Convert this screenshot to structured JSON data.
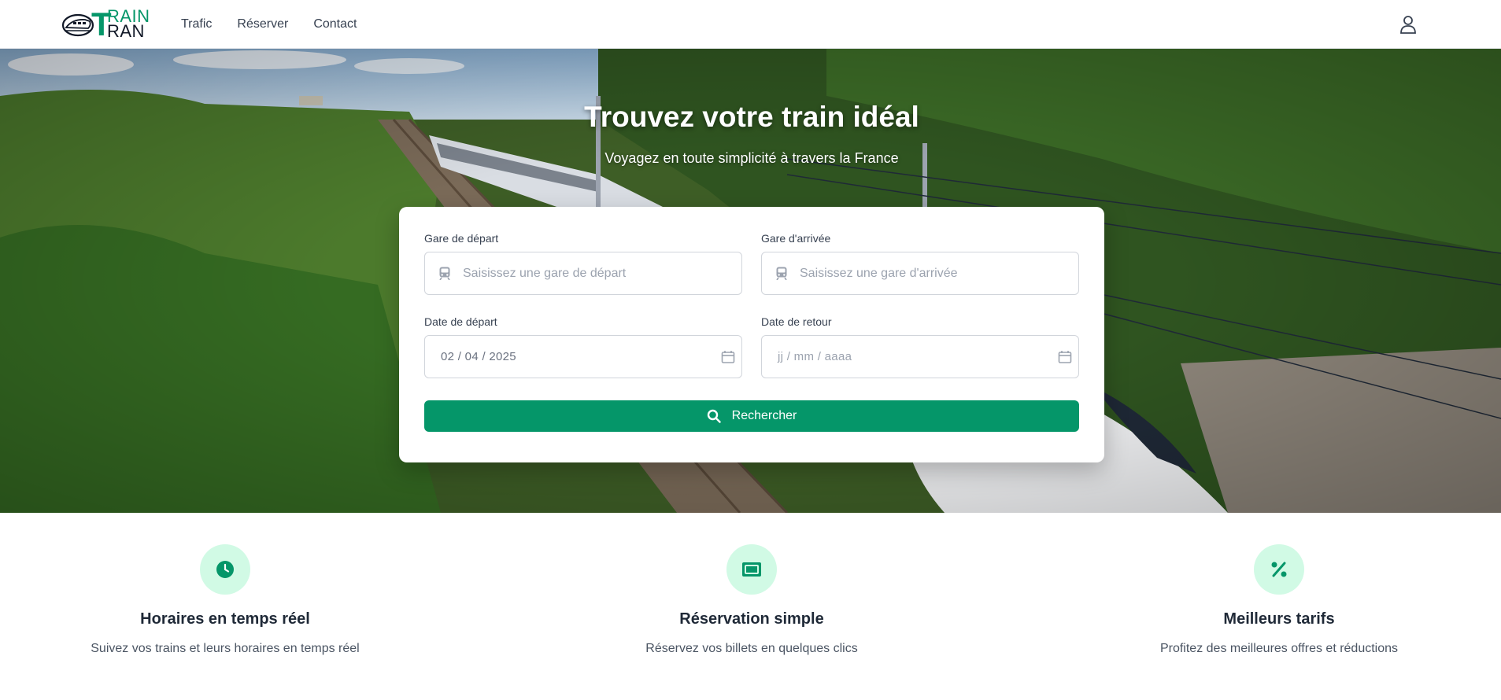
{
  "brand": {
    "name_line1": "RAIN",
    "name_line2": "RAN",
    "initial": "T"
  },
  "nav": {
    "links": [
      "Trafic",
      "Réserver",
      "Contact"
    ]
  },
  "hero": {
    "title": "Trouvez votre train idéal",
    "subtitle": "Voyagez en toute simplicité à travers la France"
  },
  "search": {
    "departure_label": "Gare de départ",
    "departure_placeholder": "Saisissez une gare de départ",
    "arrival_label": "Gare d'arrivée",
    "arrival_placeholder": "Saisissez une gare d'arrivée",
    "departure_date_label": "Date de départ",
    "departure_date_value": "02 / 04 / 2025",
    "return_date_label": "Date de retour",
    "return_date_placeholder": "jj / mm / aaaa",
    "button_label": "Rechercher"
  },
  "features": [
    {
      "icon": "clock-icon",
      "title": "Horaires en temps réel",
      "text": "Suivez vos trains et leurs horaires en temps réel"
    },
    {
      "icon": "ticket-icon",
      "title": "Réservation simple",
      "text": "Réservez vos billets en quelques clics"
    },
    {
      "icon": "percent-icon",
      "title": "Meilleurs tarifs",
      "text": "Profitez des meilleures offres et réductions"
    }
  ],
  "colors": {
    "accent": "#059669",
    "accent_light": "#d1fae5"
  }
}
